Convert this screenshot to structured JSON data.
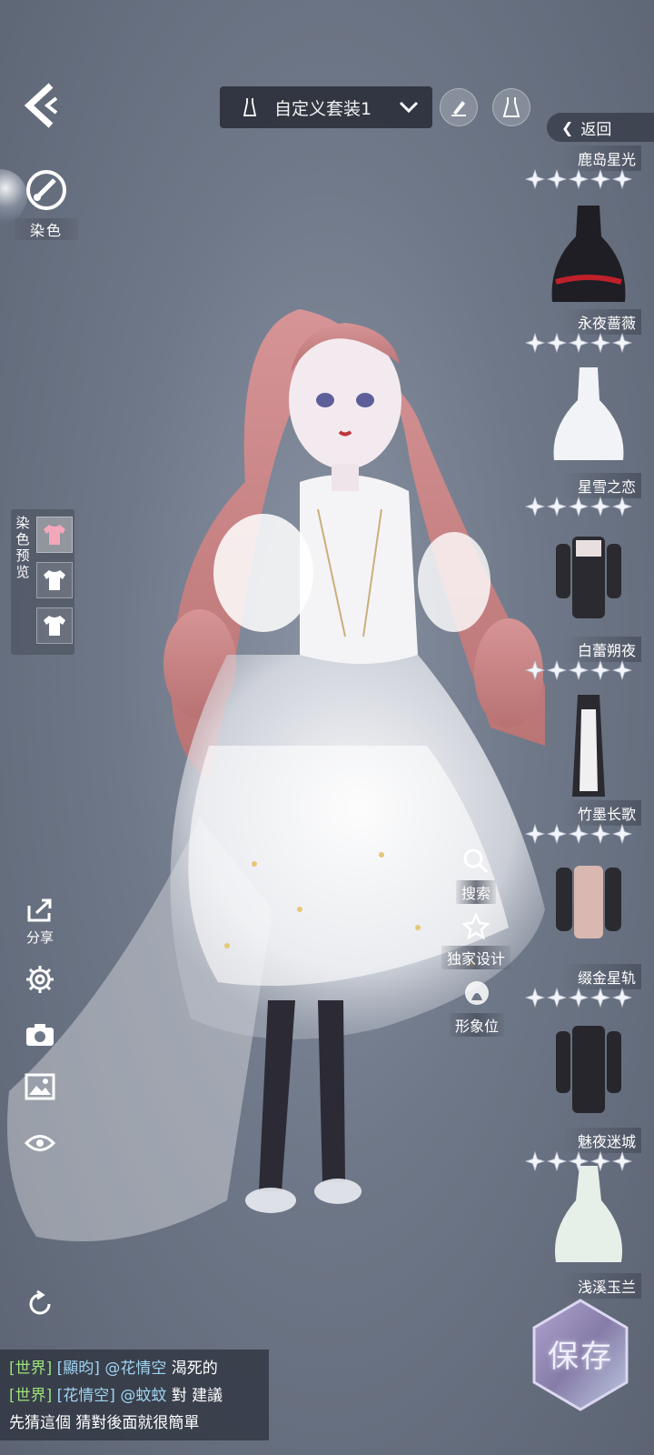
{
  "topbar": {
    "suit_name": "自定义套装1",
    "return_label": "返回"
  },
  "left": {
    "dye_label": "染色",
    "preview_label": [
      "染",
      "色",
      "预",
      "览"
    ],
    "share_label": "分享"
  },
  "actions": {
    "search_label": "搜索",
    "exclusive_label": "独家设计",
    "image_label": "形象位"
  },
  "outfits": [
    {
      "name": "鹿岛星光",
      "stars": 5
    },
    {
      "name": "永夜蔷薇",
      "stars": 5
    },
    {
      "name": "星雪之恋",
      "stars": 5
    },
    {
      "name": "白蕾朔夜",
      "stars": 5
    },
    {
      "name": "竹墨长歌",
      "stars": 5
    },
    {
      "name": "缀金星轨",
      "stars": 5
    },
    {
      "name": "魅夜迷城",
      "stars": 5
    },
    {
      "name": "浅溪玉兰",
      "stars": 5
    }
  ],
  "save_label": "保存",
  "chat": [
    {
      "channel": "[世界]",
      "user": "[顯昀]",
      "mention": "@花情空",
      "text": "渴死的"
    },
    {
      "channel": "[世界]",
      "user": "[花情空]",
      "mention": "@蚊蚊",
      "text": "對 建議"
    },
    {
      "channel": "",
      "user": "",
      "mention": "",
      "text": "先猜這個 猜對後面就很簡單"
    }
  ],
  "colors": {
    "background": "#6f7888",
    "chat_channel": "#9be07a",
    "chat_user": "#9fd4f0"
  }
}
